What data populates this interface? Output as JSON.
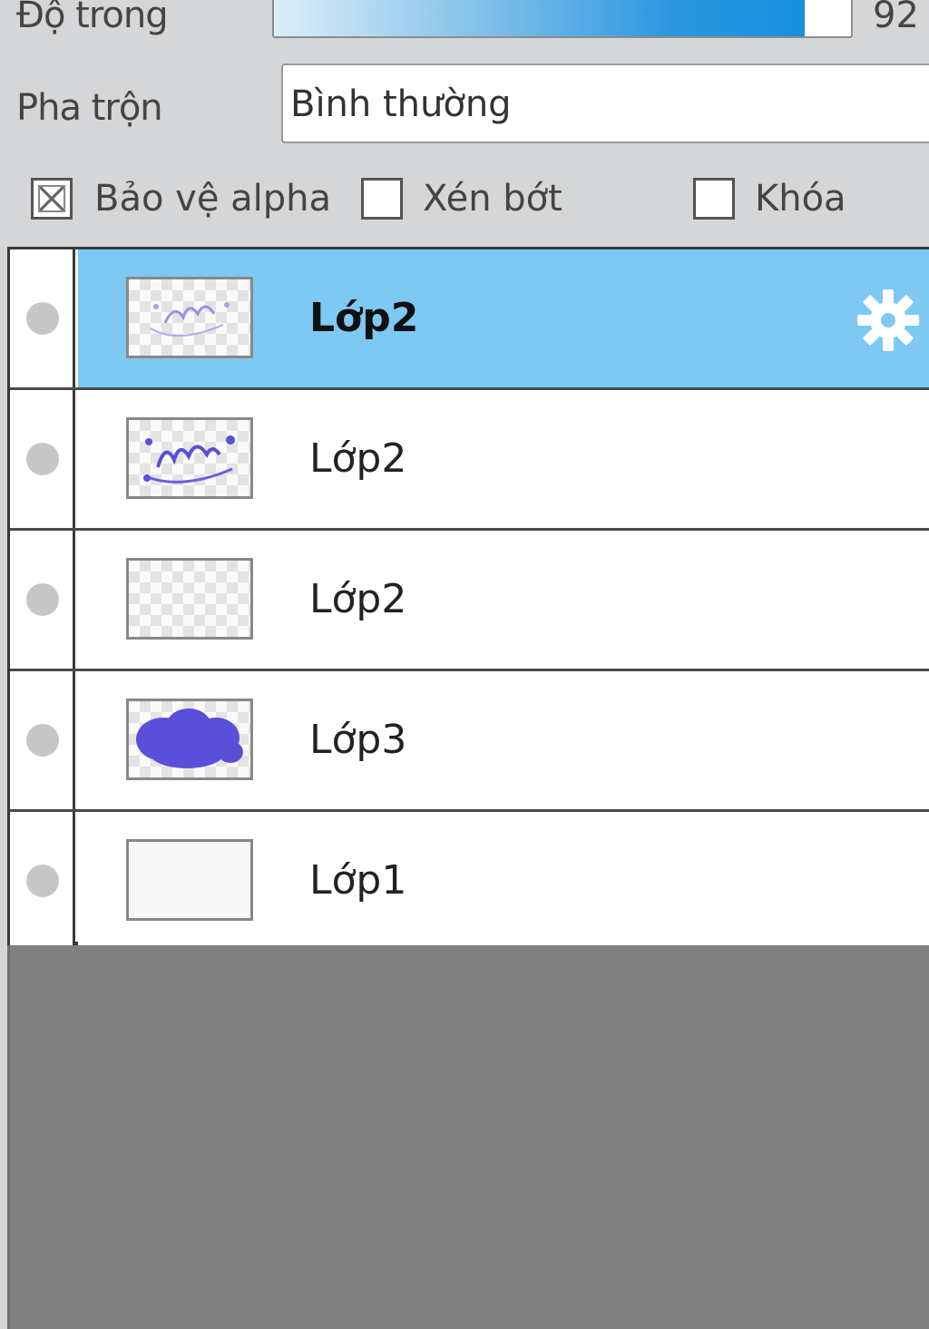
{
  "properties": {
    "opacity_label": "Độ trong",
    "opacity_value": "92",
    "opacity_fraction": 0.92,
    "blend_label": "Pha trộn",
    "blend_value": "Bình thường",
    "protect_alpha_label": "Bảo vệ alpha",
    "protect_alpha_checked": true,
    "clip_label": "Xén bớt",
    "clip_checked": false,
    "lock_label": "Khóa",
    "lock_checked": false
  },
  "layers": [
    {
      "name": "Lớp2",
      "selected": true,
      "thumbnail": "faint-purple-text"
    },
    {
      "name": "Lớp2",
      "selected": false,
      "thumbnail": "purple-text"
    },
    {
      "name": "Lớp2",
      "selected": false,
      "thumbnail": "transparent"
    },
    {
      "name": "Lớp3",
      "selected": false,
      "thumbnail": "purple-cloud"
    },
    {
      "name": "Lớp1",
      "selected": false,
      "thumbnail": "white-fill"
    }
  ],
  "colors": {
    "selection": "#7dc9f4",
    "accent": "#1590e0",
    "thumbnail_purple": "#5a4fd8"
  },
  "icons": {
    "visibility": "visibility-dot-icon",
    "layer_settings": "gear-icon"
  }
}
